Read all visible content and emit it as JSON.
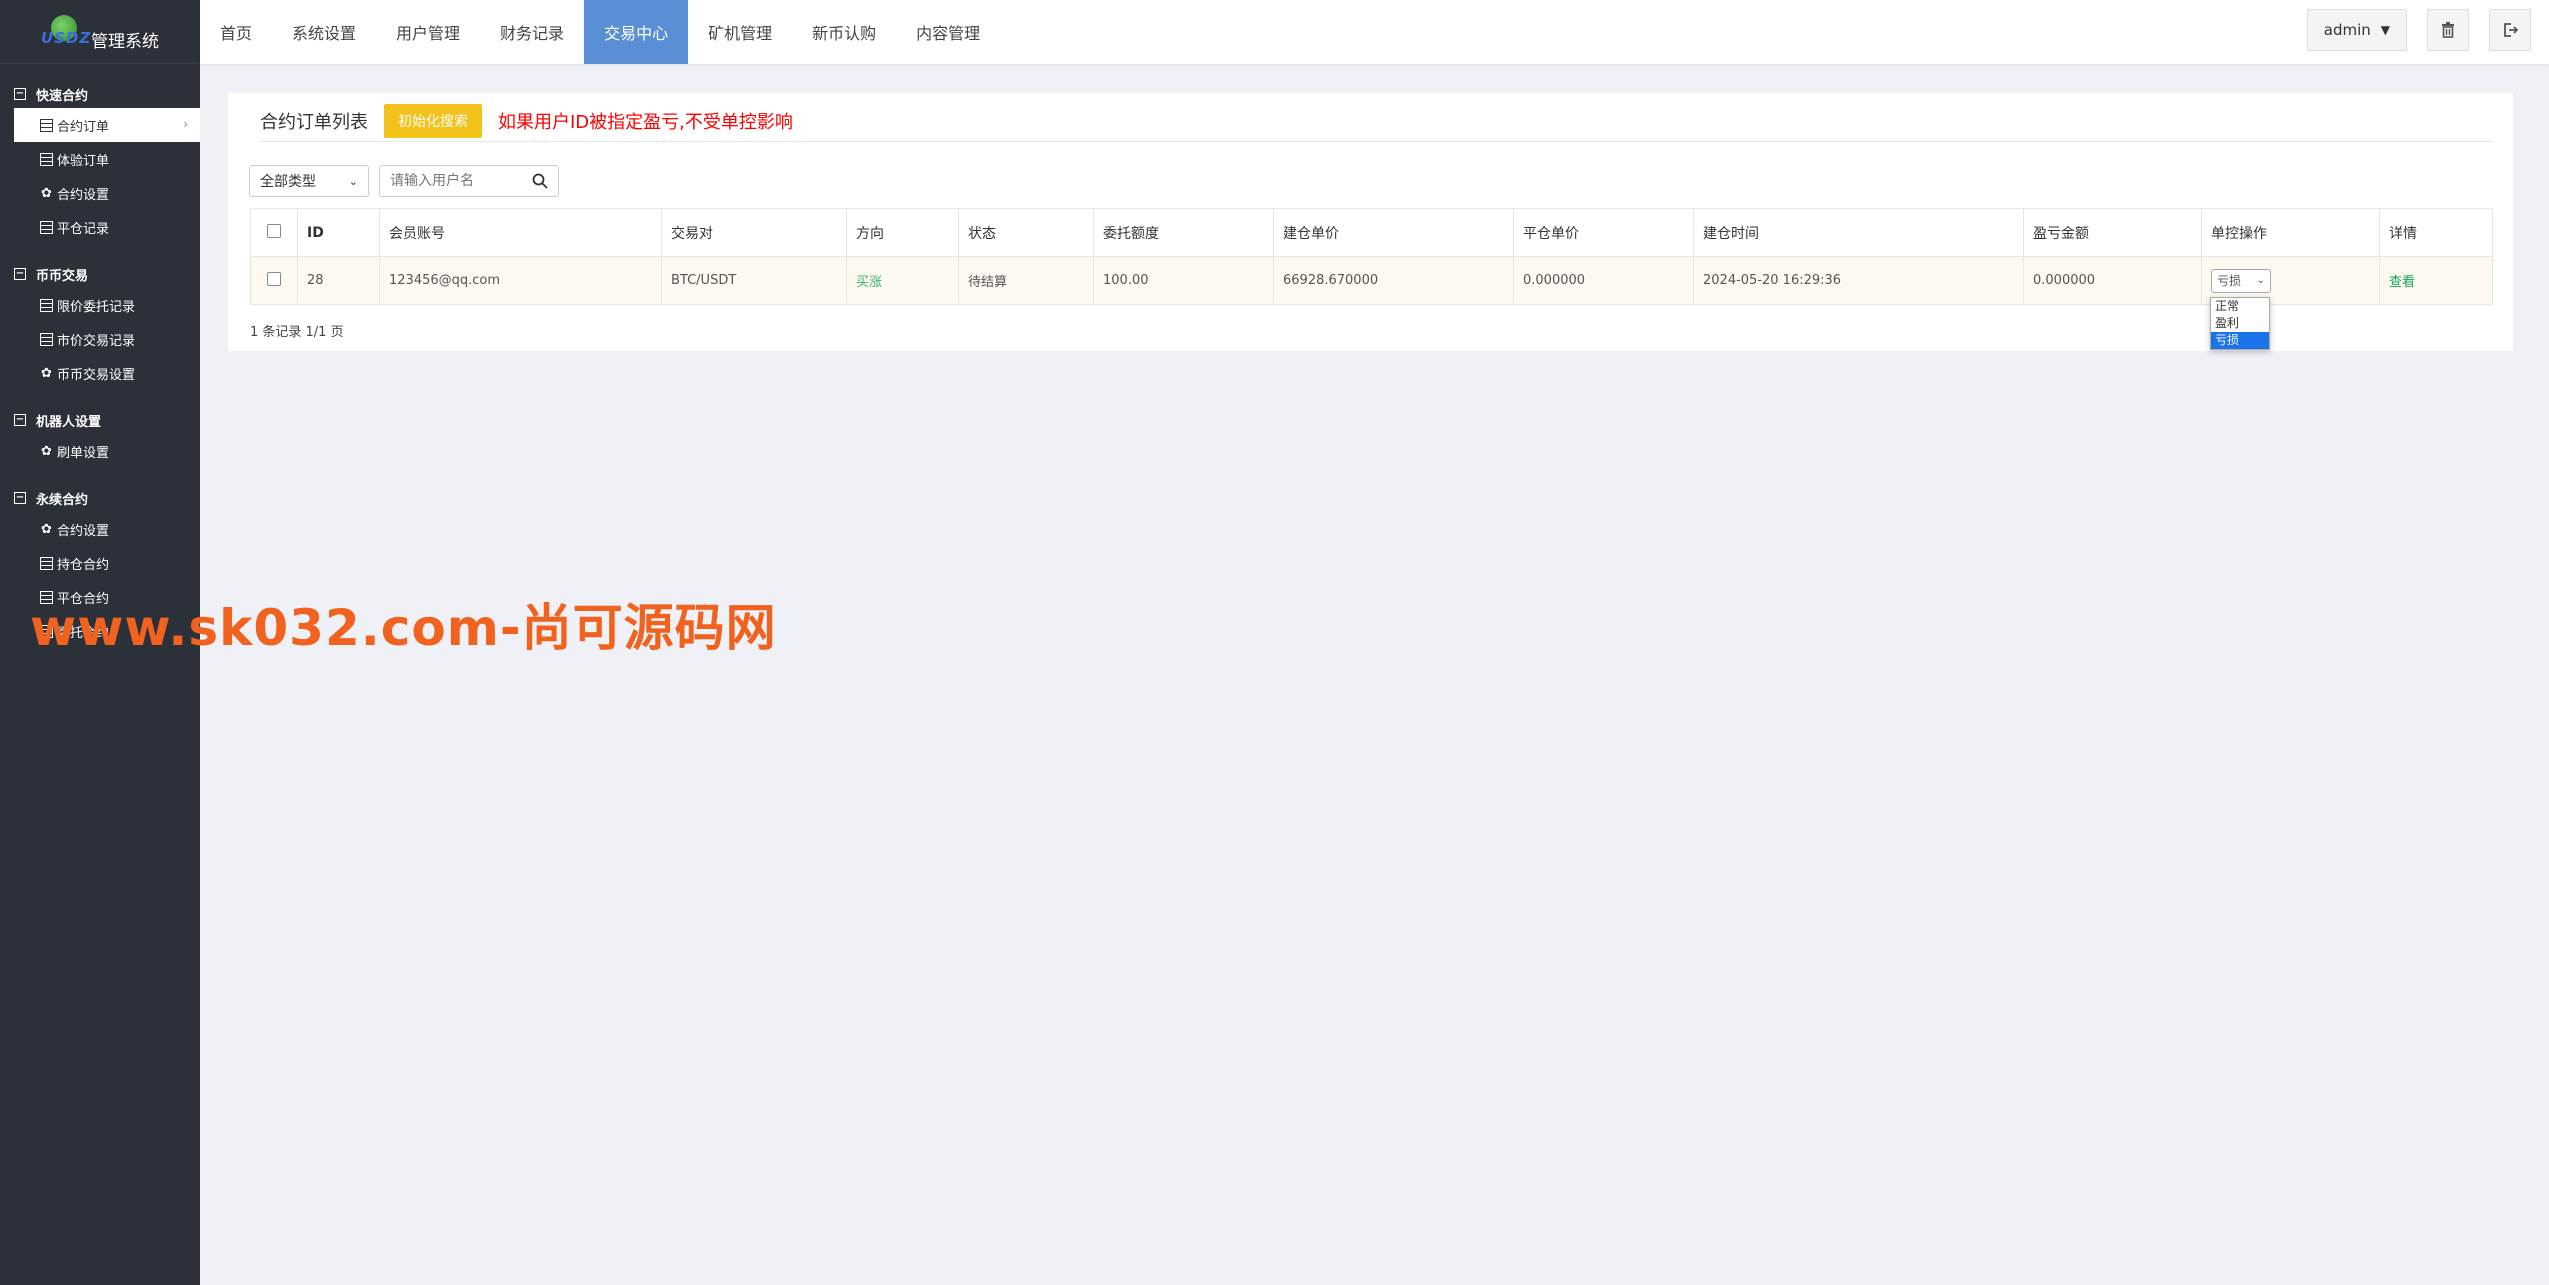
{
  "app": {
    "logo_text": "USDZ",
    "title": "管理系统"
  },
  "sidebar": {
    "groups": [
      {
        "label": "快速合约",
        "items": [
          {
            "label": "合约订单",
            "icon": "table-icon"
          },
          {
            "label": "体验订单",
            "icon": "table-icon"
          },
          {
            "label": "合约设置",
            "icon": "gear-icon"
          },
          {
            "label": "平仓记录",
            "icon": "table-icon"
          }
        ]
      },
      {
        "label": "币币交易",
        "items": [
          {
            "label": "限价委托记录",
            "icon": "table-icon"
          },
          {
            "label": "市价交易记录",
            "icon": "table-icon"
          },
          {
            "label": "币币交易设置",
            "icon": "gear-icon"
          }
        ]
      },
      {
        "label": "机器人设置",
        "items": [
          {
            "label": "刷单设置",
            "icon": "gear-icon"
          }
        ]
      },
      {
        "label": "永续合约",
        "items": [
          {
            "label": "合约设置",
            "icon": "gear-icon"
          },
          {
            "label": "持仓合约",
            "icon": "table-icon"
          },
          {
            "label": "平仓合约",
            "icon": "table-icon"
          },
          {
            "label": "委托合约",
            "icon": "table-icon"
          }
        ]
      }
    ]
  },
  "topnav": [
    "首页",
    "系统设置",
    "用户管理",
    "财务记录",
    "交易中心",
    "矿机管理",
    "新币认购",
    "内容管理"
  ],
  "user": {
    "name": "admin"
  },
  "panel": {
    "title": "合约订单列表",
    "reset_label": "初始化搜索",
    "warning": "如果用户ID被指定盈亏,不受单控影响",
    "type_select": "全部类型",
    "search_placeholder": "请输入用户名"
  },
  "table": {
    "headers": [
      "ID",
      "会员账号",
      "交易对",
      "方向",
      "状态",
      "委托额度",
      "建仓单价",
      "平仓单价",
      "建仓时间",
      "盈亏金额",
      "单控操作",
      "详情"
    ],
    "rows": [
      {
        "id": "28",
        "account": "123456@qq.com",
        "pair": "BTC/USDT",
        "direction": "买涨",
        "status": "待结算",
        "amount": "100.00",
        "open_price": "66928.670000",
        "close_price": "0.000000",
        "open_time": "2024-05-20 16:29:36",
        "pnl": "0.000000",
        "control": "亏损",
        "detail": "查看"
      }
    ],
    "footer": "1 条记录 1/1 页"
  },
  "dropdown_options": [
    "正常",
    "盈利",
    "亏损"
  ],
  "watermark": "www.sk032.com-尚可源码网",
  "colors": {
    "sidebar_bg": "#2b3039",
    "active_tab": "#5b8fd5",
    "reset_button": "#f3c21a",
    "warning_text": "#ff0000",
    "watermark": "#f0621e"
  }
}
